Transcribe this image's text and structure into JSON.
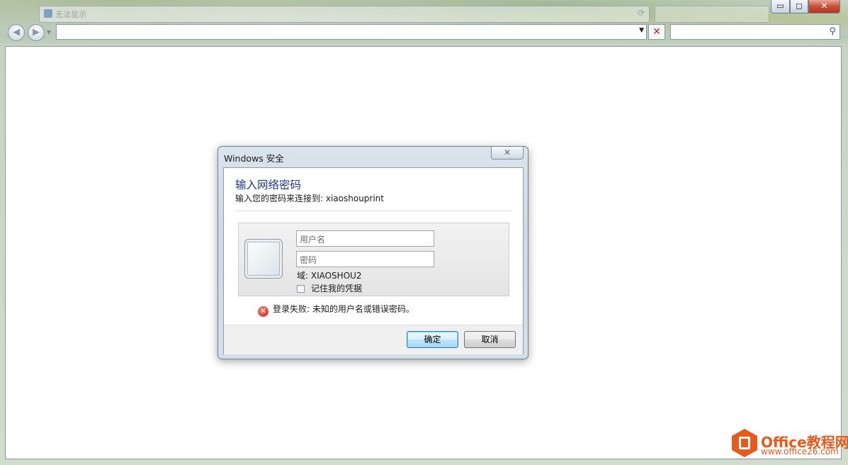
{
  "browser": {
    "tab_title": "无法显示",
    "address_value": "",
    "search_value": "",
    "window_controls": {
      "minimize": "▭",
      "maximize": "◻",
      "close": "✕"
    },
    "nav_back_glyph": "◀",
    "nav_forward_glyph": "▶"
  },
  "dialog": {
    "title": "Windows 安全",
    "close_glyph": "✕",
    "heading": "输入网络密码",
    "subtitle": "输入您的密码来连接到: xiaoshouprint",
    "username_placeholder": "用户名",
    "password_placeholder": "密码",
    "domain_text": "域: XIAOSHOU2",
    "remember_label": "记住我的凭据",
    "remember_checked": false,
    "error_text": "登录失败: 未知的用户名或错误密码。",
    "ok_label": "确定",
    "cancel_label": "取消"
  },
  "watermark": {
    "brand": "Office教程网",
    "url": "www.office26.com"
  },
  "colors": {
    "dialog_heading": "#1e3a8a",
    "close_red": "#c7503a",
    "error_red": "#c8181b",
    "watermark_orange": "#e8591b"
  }
}
